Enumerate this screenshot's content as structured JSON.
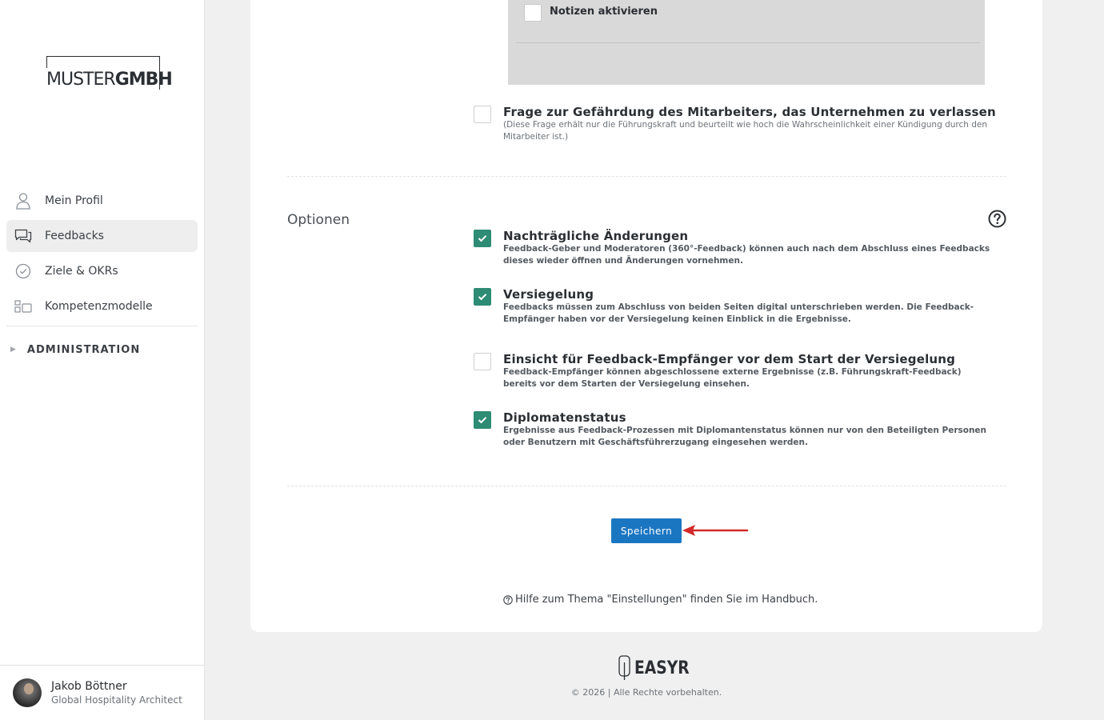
{
  "sidebar": {
    "logo": {
      "part1": "MUSTER",
      "part2": "GMBH"
    },
    "items": [
      {
        "label": "Mein Profil",
        "icon": "user-icon"
      },
      {
        "label": "Feedbacks",
        "icon": "chat-icon"
      },
      {
        "label": "Ziele & OKRs",
        "icon": "check-circle-icon"
      },
      {
        "label": "Kompetenzmodelle",
        "icon": "grid-icon"
      }
    ],
    "admin_label": "ADMINISTRATION",
    "user": {
      "name": "Jakob Böttner",
      "role": "Global Hospitality Architect"
    }
  },
  "notes": {
    "label": "Notizen aktivieren"
  },
  "risk_question": {
    "title": "Frage zur Gefährdung des Mitarbeiters, das Unternehmen zu verlassen",
    "description": "(Diese Frage erhält nur die Führungskraft und beurteilt wie hoch die Wahrscheinlichkeit einer Kündigung durch den Mitarbeiter ist.)",
    "checked": false
  },
  "options": {
    "section_title": "Optionen",
    "items": [
      {
        "title": "Nachträgliche Änderungen",
        "description": "Feedback-Geber und Moderatoren (360°-Feedback) können auch nach dem Abschluss eines Feedbacks dieses wieder öffnen und Änderungen vornehmen.",
        "checked": true
      },
      {
        "title": "Versiegelung",
        "description": "Feedbacks müssen zum Abschluss von beiden Seiten digital unterschrieben werden. Die Feedback-Empfänger haben vor der Versiegelung keinen Einblick in die Ergebnisse.",
        "checked": true
      },
      {
        "title": "Einsicht für Feedback-Empfänger vor dem Start der Versiegelung",
        "description": "Feedback-Empfänger können abgeschlossene externe Ergebnisse (z.B. Führungskraft-Feedback) bereits vor dem Starten der Versiegelung einsehen.",
        "checked": false
      },
      {
        "title": "Diplomatenstatus",
        "description": "Ergebnisse aus Feedback-Prozessen mit Diplomantenstatus können nur von den Beteiligten Personen oder Benutzern mit Geschäftsführerzugang eingesehen werden.",
        "checked": true
      }
    ]
  },
  "actions": {
    "save_label": "Speichern"
  },
  "help": {
    "text": "Hilfe zum Thema \"Einstellungen\" finden Sie im Handbuch."
  },
  "footer": {
    "brand": "EASYR",
    "copyright": "© 2026 | Alle Rechte vorbehalten."
  },
  "colors": {
    "accent": "#1b76c2",
    "checkbox": "#2e8b74",
    "arrow": "#d42a2a"
  }
}
